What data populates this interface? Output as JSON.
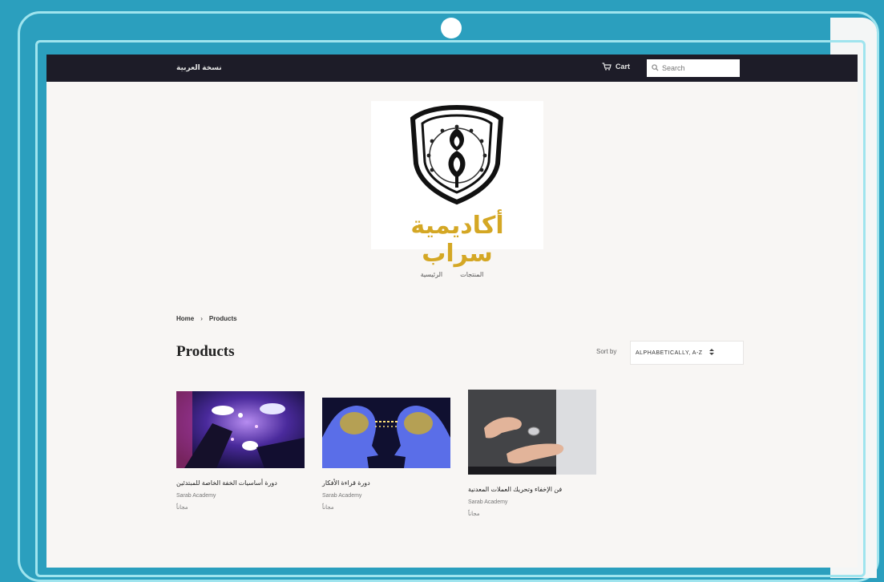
{
  "header": {
    "language_link": "نسخة العربية",
    "cart_label": "Cart",
    "search_placeholder": "Search"
  },
  "logo": {
    "brand_text": "أكاديمية سراب"
  },
  "nav": {
    "items": [
      {
        "label": "الرئيسية"
      },
      {
        "label": "المنتجات"
      }
    ]
  },
  "breadcrumb": {
    "home": "Home",
    "separator": "›",
    "current": "Products"
  },
  "collection": {
    "title": "Products",
    "sort_label": "Sort by",
    "sort_value": "ALPHABETICALLY, A-Z",
    "sort_options": [
      "ALPHABETICALLY, A-Z"
    ]
  },
  "products": [
    {
      "name": "دورة أساسيات الخفة الخاصة للمبتدئين",
      "vendor": "Sarab Academy",
      "price": "مجاناً",
      "image": "magician-hands-purple"
    },
    {
      "name": "دورة قراءة الأفكار",
      "vendor": "Sarab Academy",
      "price": "مجاناً",
      "image": "two-heads-brains-blue"
    },
    {
      "name": "فن الإخفاء وتحريك العملات المعدنية",
      "vendor": "Sarab Academy",
      "price": "مجاناً",
      "image": "hands-coin-trick"
    }
  ],
  "colors": {
    "device_frame": "#2b9fbe",
    "frame_line": "#9fe4ee",
    "topbar": "#1d1c28",
    "page_bg": "#f8f6f4",
    "brand_gold": "#d4a724"
  }
}
